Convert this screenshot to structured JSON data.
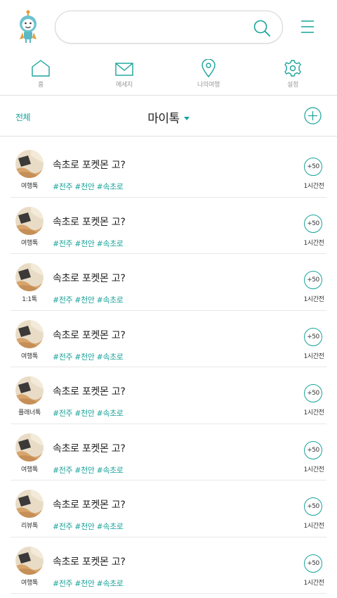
{
  "search": {
    "value": "",
    "placeholder": ""
  },
  "nav": [
    {
      "label": "홈",
      "icon": "home-icon"
    },
    {
      "label": "메세지",
      "icon": "mail-icon"
    },
    {
      "label": "나의여행",
      "icon": "location-pin-icon"
    },
    {
      "label": "설정",
      "icon": "gear-icon"
    }
  ],
  "subhead": {
    "all_label": "전체",
    "title": "마이톡"
  },
  "colors": {
    "accent": "#1aa39a",
    "divider": "#e0e0e0",
    "text": "#222222"
  },
  "posts": [
    {
      "category": "여행톡",
      "title": "속초로 포켓몬 고?",
      "tags": [
        "#전주",
        "#천안",
        "#속초로"
      ],
      "badge": "+50",
      "time": "1시간전"
    },
    {
      "category": "여행톡",
      "title": "속초로 포켓몬 고?",
      "tags": [
        "#전주",
        "#천안",
        "#속초로"
      ],
      "badge": "+50",
      "time": "1시간전"
    },
    {
      "category": "1:1톡",
      "title": "속초로 포켓몬 고?",
      "tags": [
        "#전주",
        "#천안",
        "#속초로"
      ],
      "badge": "+50",
      "time": "1시간전"
    },
    {
      "category": "여행톡",
      "title": "속초로 포켓몬 고?",
      "tags": [
        "#전주",
        "#천안",
        "#속초로"
      ],
      "badge": "+50",
      "time": "1시간전"
    },
    {
      "category": "플래너톡",
      "title": "속초로 포켓몬 고?",
      "tags": [
        "#전주",
        "#천안",
        "#속초로"
      ],
      "badge": "+50",
      "time": "1시간전"
    },
    {
      "category": "여행톡",
      "title": "속초로 포켓몬 고?",
      "tags": [
        "#전주",
        "#천안",
        "#속초로"
      ],
      "badge": "+50",
      "time": "1시간전"
    },
    {
      "category": "리뷰톡",
      "title": "속초로 포켓몬 고?",
      "tags": [
        "#전주",
        "#천안",
        "#속초로"
      ],
      "badge": "+50",
      "time": "1시간전"
    },
    {
      "category": "여행톡",
      "title": "속초로 포켓몬 고?",
      "tags": [
        "#전주",
        "#천안",
        "#속초로"
      ],
      "badge": "+50",
      "time": "1시간전"
    }
  ]
}
